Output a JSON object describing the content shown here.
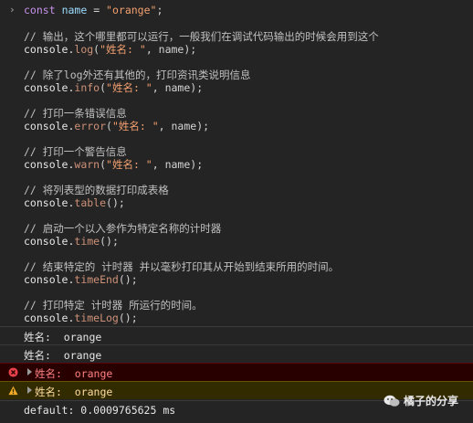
{
  "prompt_symbol": "›",
  "code": {
    "line1": {
      "kw": "const",
      "ident": "name",
      "eq": " = ",
      "str": "\"orange\"",
      "end": ";"
    },
    "c1": "// 输出，这个哪里都可以运行，一般我们在调试代码输出的时候会用到这个",
    "s1": {
      "obj": "console.",
      "method": "log",
      "open": "(",
      "str": "\"姓名: \"",
      "rest": ", name);"
    },
    "c2": "// 除了log外还有其他的，打印资讯类说明信息",
    "s2": {
      "obj": "console.",
      "method": "info",
      "open": "(",
      "str": "\"姓名: \"",
      "rest": ", name);"
    },
    "c3": "// 打印一条错误信息",
    "s3": {
      "obj": "console.",
      "method": "error",
      "open": "(",
      "str": "\"姓名: \"",
      "rest": ", name);"
    },
    "c4": "// 打印一个警告信息",
    "s4": {
      "obj": "console.",
      "method": "warn",
      "open": "(",
      "str": "\"姓名: \"",
      "rest": ", name);"
    },
    "c5": "// 将列表型的数据打印成表格",
    "s5": {
      "obj": "console.",
      "method": "table",
      "rest": "();"
    },
    "c6": "// 启动一个以入参作为特定名称的计时器",
    "s6": {
      "obj": "console.",
      "method": "time",
      "rest": "();"
    },
    "c7": "// 结束特定的 计时器 并以毫秒打印其从开始到结束所用的时间。",
    "s7": {
      "obj": "console.",
      "method": "timeEnd",
      "rest": "();"
    },
    "c8": "// 打印特定 计时器 所运行的时间。",
    "s8": {
      "obj": "console.",
      "method": "timeLog",
      "rest": "();"
    }
  },
  "output": {
    "log": "姓名:  orange",
    "info": "姓名:  orange",
    "error": "姓名:  orange",
    "warn": "姓名:  orange",
    "default": "default: 0.0009765625 ms"
  },
  "colors": {
    "error_icon": "#e8414a",
    "warn_icon": "#f2ab26"
  },
  "icons": {
    "error": "error-circle-icon",
    "warn": "warning-triangle-icon",
    "expand": "expand-triangle-icon",
    "watermark": "wechat-icon"
  },
  "watermark": {
    "text": "橘子的分享"
  }
}
